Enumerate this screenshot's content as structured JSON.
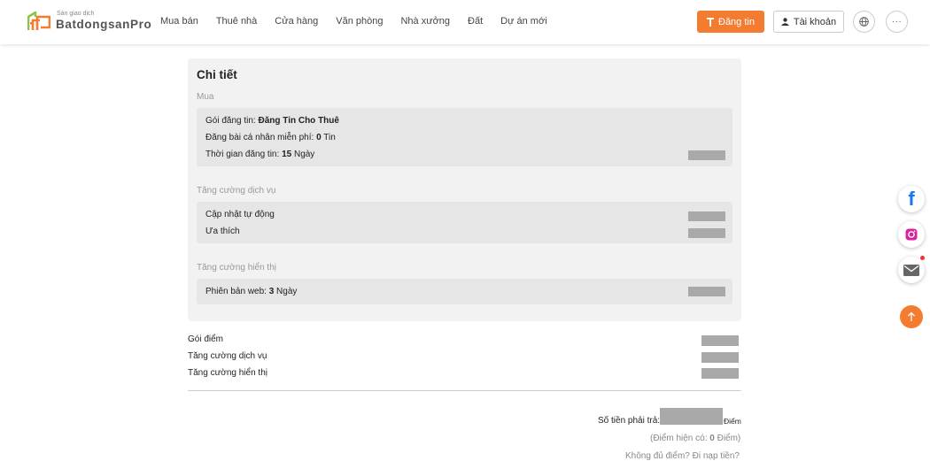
{
  "header": {
    "logo_small": "Sàn giao dịch",
    "logo_main": "BatdongsanPro",
    "nav": [
      "Mua bán",
      "Thuê nhà",
      "Cửa hàng",
      "Văn phòng",
      "Nhà xưởng",
      "Đất",
      "Dự án mới"
    ],
    "post_label": "Đăng tin",
    "account_label": "Tài khoản",
    "brand_color": "#f47c30"
  },
  "detail": {
    "title": "Chi tiết",
    "section_buy": "Mua",
    "package_label": "Gói đăng tin: ",
    "package_value": "Đăng Tin Cho Thuê",
    "free_label": "Đăng bài cá nhân miễn phí: ",
    "free_value": "0",
    "free_unit": " Tin",
    "duration_label": "Thời gian đăng tin: ",
    "duration_value": "15",
    "duration_unit": " Ngày",
    "section_service": "Tăng cường dịch vụ",
    "service_items": [
      "Cập nhật tự động",
      "Ưa thích"
    ],
    "section_display": "Tăng cường hiển thị",
    "web_label": "Phiên bản web: ",
    "web_value": "3",
    "web_unit": " Ngày"
  },
  "summary": {
    "items": [
      "Gói điểm",
      "Tăng cường dịch vụ",
      "Tăng cường hiển thị"
    ],
    "total_label": "Số tiền phải trả:",
    "total_unit": "Điểm",
    "current_prefix": "(Điểm hiện có: ",
    "current_value": "0",
    "current_suffix": " Điểm)",
    "topup_text": "Không đủ điểm? Đi nạp tiền?"
  },
  "side_icons": [
    "facebook-icon",
    "instagram-icon",
    "mail-icon",
    "scroll-top-icon"
  ]
}
